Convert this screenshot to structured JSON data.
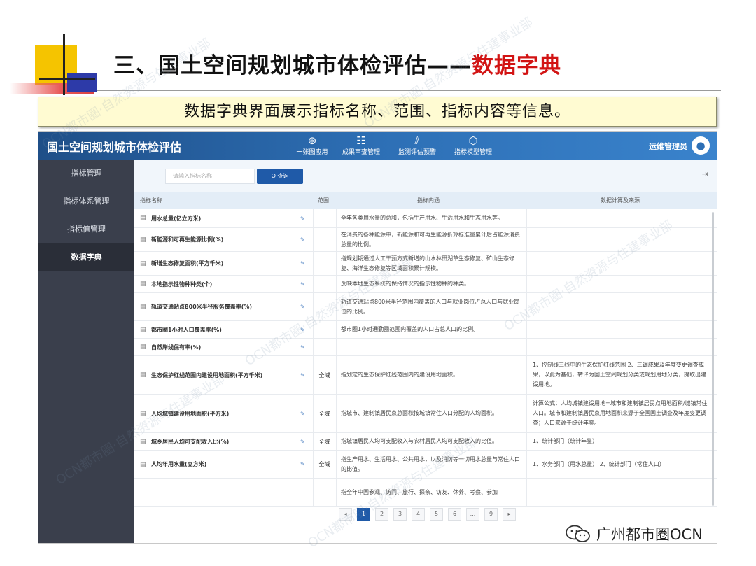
{
  "slide": {
    "title_main": "三、国土空间规划城市体检评估——",
    "title_highlight": "数据字典",
    "subtitle": "数据字典界面展示指标名称、范围、指标内容等信息。"
  },
  "app": {
    "title": "国土空间规划城市体检评估",
    "nav": [
      {
        "icon": "compass-icon",
        "label": "一张图应用"
      },
      {
        "icon": "document-review-icon",
        "label": "成果审查管理"
      },
      {
        "icon": "chart-warning-icon",
        "label": "监测评估预警"
      },
      {
        "icon": "cube-icon",
        "label": "指标模型管理"
      }
    ],
    "user_name": "运维管理员",
    "sidebar": [
      {
        "label": "指标管理",
        "active": false
      },
      {
        "label": "指标体系管理",
        "active": false
      },
      {
        "label": "指标值管理",
        "active": false
      },
      {
        "label": "数据字典",
        "active": true
      }
    ],
    "search": {
      "placeholder": "请输入指标名称",
      "button_label": "Q 查询"
    },
    "columns": {
      "name": "指标名称",
      "range": "范围",
      "content": "指标内涵",
      "calc": "数据计算及来源"
    },
    "rows": [
      {
        "name": "用水总量(亿立方米)",
        "range": "",
        "content": "全年各类用水量的总和，包括生产用水、生活用水和生态用水等。",
        "calc": ""
      },
      {
        "name": "新能源和可再生能源比例(%)",
        "range": "",
        "content": "在消费的各种能源中，新能源和可再生能源折算标准量累计后占能源消费总量的比例。",
        "calc": ""
      },
      {
        "name": "新增生态修复面积(平方千米)",
        "range": "",
        "content": "指规划期通过人工干预方式新增的山水林田湖草生态修复、矿山生态修复、海洋生态修复等区域面积累计规模。",
        "calc": ""
      },
      {
        "name": "本地指示性物种种类(个)",
        "range": "",
        "content": "反映本地生态系统的保持情况的指示性物种的种类。",
        "calc": ""
      },
      {
        "name": "轨道交通站点800米半径服务覆盖率(%)",
        "range": "",
        "content": "轨道交通站点800米半径范围内覆盖的人口与就业岗位占总人口与就业岗位的比例。",
        "calc": ""
      },
      {
        "name": "都市圈1小时人口覆盖率(%)",
        "range": "",
        "content": "都市圈1小时通勤圈范围内覆盖的人口占总人口的比例。",
        "calc": ""
      },
      {
        "name": "自然岸线保有率(%)",
        "range": "",
        "content": "",
        "calc": ""
      },
      {
        "name": "生态保护红线范围内建设用地面积(平方千米)",
        "range": "全域",
        "content": "指划定的生态保护红线范围内的建设用地面积。",
        "calc": "1、控制线三线中的生态保护红线范围 2、三调成果及年度变更调查成果，以此为基础，转译为国土空间规划分类或规划用地分类，提取出建设用地。"
      },
      {
        "name": "人均城镇建设用地面积(平方米)",
        "range": "全域",
        "content": "指城市、建制镇居民点总面积按城镇常住人口分配的人均面积。",
        "calc": "计算公式：人均城镇建设用地=城市和建制镇居民点用地面积/城镇常住人口。城市和建制镇居民点用地面积来源于全国国土调查及年度变更调查；人口来源于统计年鉴。"
      },
      {
        "name": "城乡居民人均可支配收入比(%)",
        "range": "全域",
        "content": "指城镇居民人均可支配收入与农村居民人均可支配收入的比值。",
        "calc": "1、统计部门（统计年鉴）"
      },
      {
        "name": "人均年用水量(立方米)",
        "range": "全域",
        "content": "指生产用水、生活用水、公共用水，以及消防等一切用水总量与常住人口的比值。",
        "calc": "1、水务部门（用水总量） 2、统计部门（常住人口）"
      },
      {
        "name": "",
        "range": "",
        "content": "指全年中国参观、访问、旅行、探亲、访友、休养、考察、参加",
        "calc": ""
      }
    ],
    "pager": [
      "◂",
      "1",
      "2",
      "3",
      "4",
      "5",
      "6",
      "...",
      "9",
      "▸"
    ],
    "pager_active": "1"
  },
  "watermark": "OCN都市圈·自然资源与住建事业部",
  "logo": {
    "text": "广州都市圈OCN"
  }
}
